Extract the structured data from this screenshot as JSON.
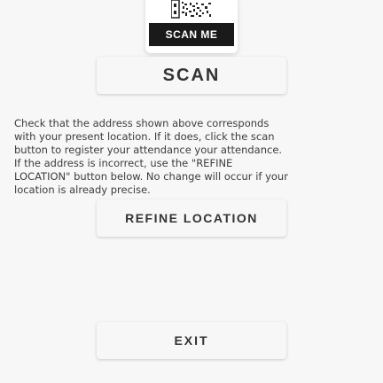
{
  "qr_badge": {
    "icon": "qr-code-icon",
    "label": "SCAN ME"
  },
  "scan_button": {
    "label": "SCAN"
  },
  "instructions": {
    "text": "Check that the address shown above corresponds\nwith your present location. If it does, click the scan\nbutton to register your attendance your attendance.\nIf the address is incorrect, use the \"REFINE\nLOCATION\" button below. No change will occur if your\nlocation is already precise."
  },
  "refine_button": {
    "label": "REFINE LOCATION"
  },
  "exit_button": {
    "label": "EXIT"
  }
}
